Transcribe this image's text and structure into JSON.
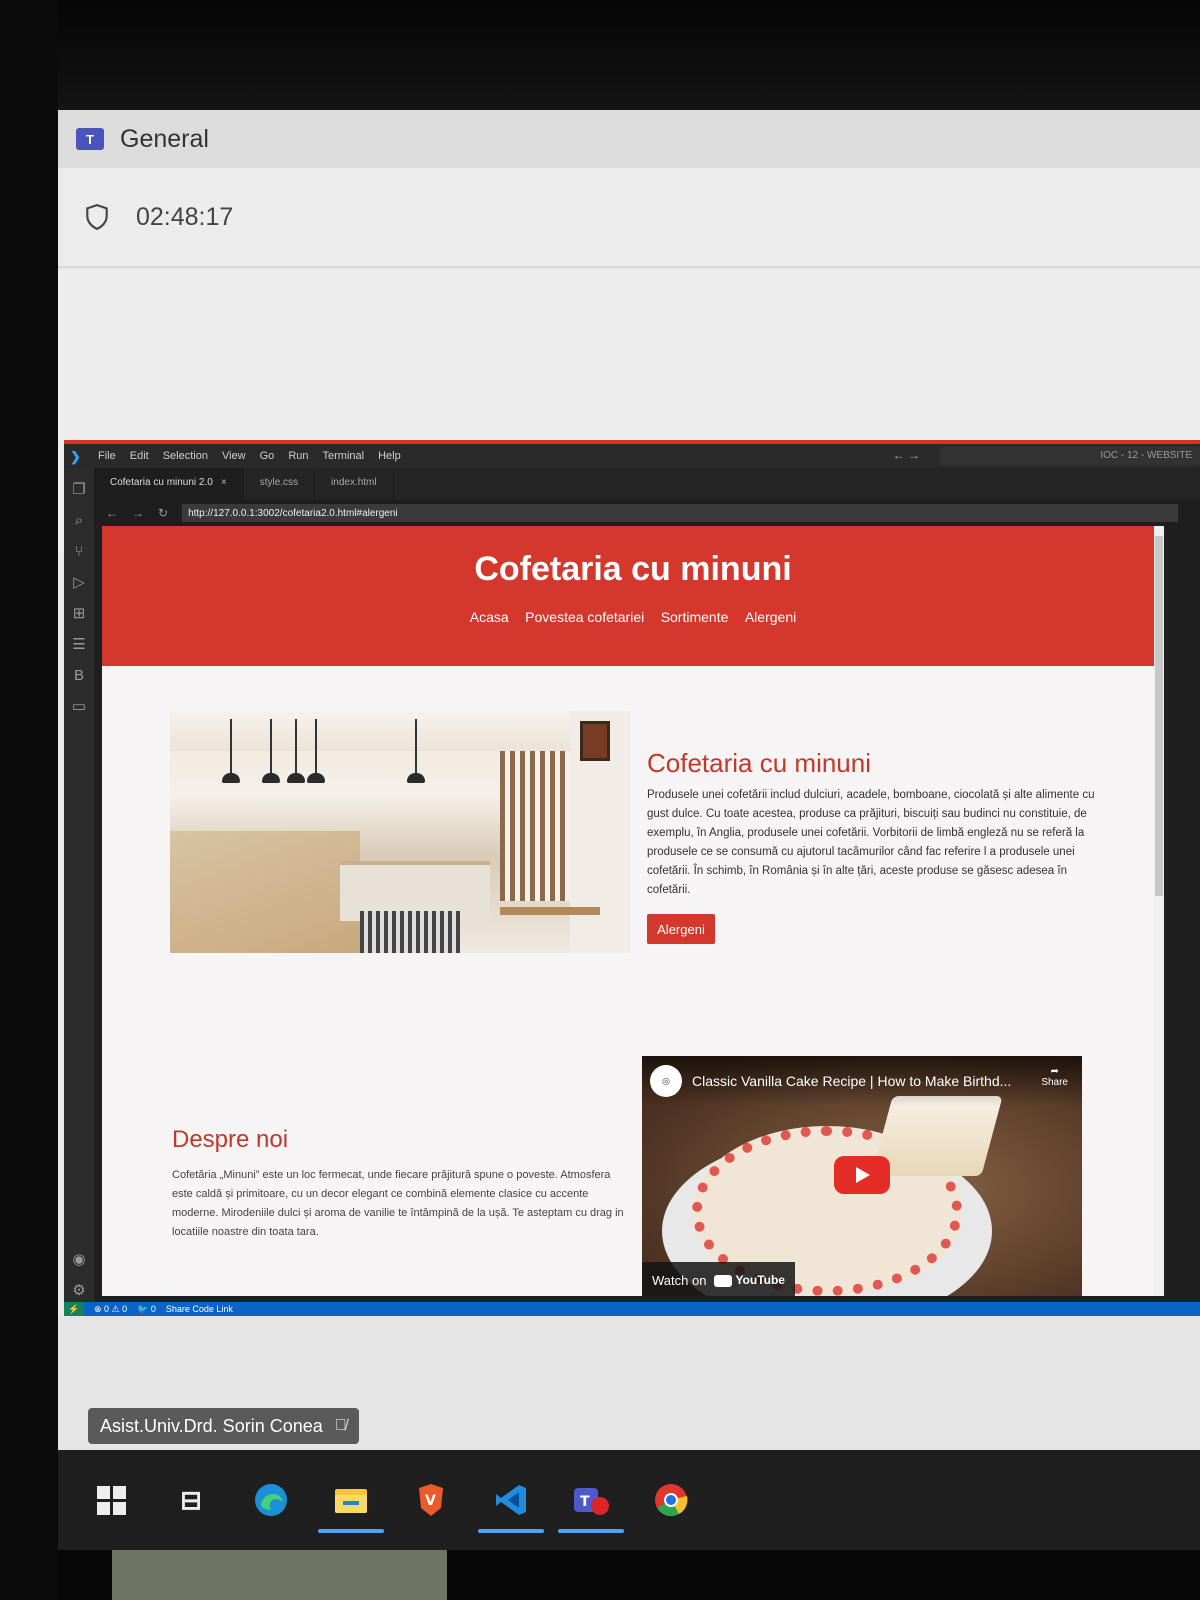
{
  "teams": {
    "channel_title": "General",
    "timer": "02:48:17"
  },
  "vscode": {
    "menu": [
      "File",
      "Edit",
      "Selection",
      "View",
      "Go",
      "Run",
      "Terminal",
      "Help"
    ],
    "search_text": "IOC - 12 - WEBSITE",
    "tabs": [
      {
        "label": "Cofetaria cu minuni 2.0",
        "active": true
      },
      {
        "label": "style.css",
        "active": false
      },
      {
        "label": "index.html",
        "active": false
      }
    ],
    "url": "http://127.0.0.1:3002/cofetaria2.0.html#alergeni",
    "status": {
      "problems": "⊗ 0 ⚠ 0",
      "ports": "🐦 0",
      "share": "Share Code Link"
    }
  },
  "site": {
    "title": "Cofetaria cu minuni",
    "nav": [
      "Acasa",
      "Povestea cofetariei",
      "Sortimente",
      "Alergeni"
    ],
    "intro": {
      "title": "Cofetaria cu minuni",
      "text": "Produsele unei cofetării includ dulciuri, acadele, bomboane, ciocolată și alte alimente cu gust dulce. Cu toate acestea, produse ca prăjituri, biscuiți sau budinci nu constituie, de exemplu, în Anglia, produsele unei cofetării. Vorbitorii de limbă engleză nu se referă la produsele ce se consumă cu ajutorul tacâmurilor când fac referire l a produsele unei cofetării. În schimb, în România și în alte țări, aceste produse se găsesc adesea în cofetării.",
      "button": "Alergeni"
    },
    "about": {
      "title": "Despre noi",
      "text": "Cofetăria „Minuni” este un loc fermecat, unde fiecare prăjitură spune o poveste. Atmosfera este caldă și primitoare, cu un decor elegant ce combină elemente clasice cu accente moderne. Mirodeniile dulci și aroma de vanilie te întâmpină de la ușă. Te asteptam cu drag in locatiile noastre din toata tara."
    },
    "video": {
      "title": "Classic Vanilla Cake Recipe | How to Make Birthd...",
      "share": "Share",
      "watch_on": "Watch on",
      "platform": "YouTube"
    }
  },
  "participant": {
    "name": "Asist.Univ.Drd. Sorin Conea"
  },
  "colors": {
    "brand_red": "#d4372b",
    "vscode_status_blue": "#0a64c8"
  }
}
